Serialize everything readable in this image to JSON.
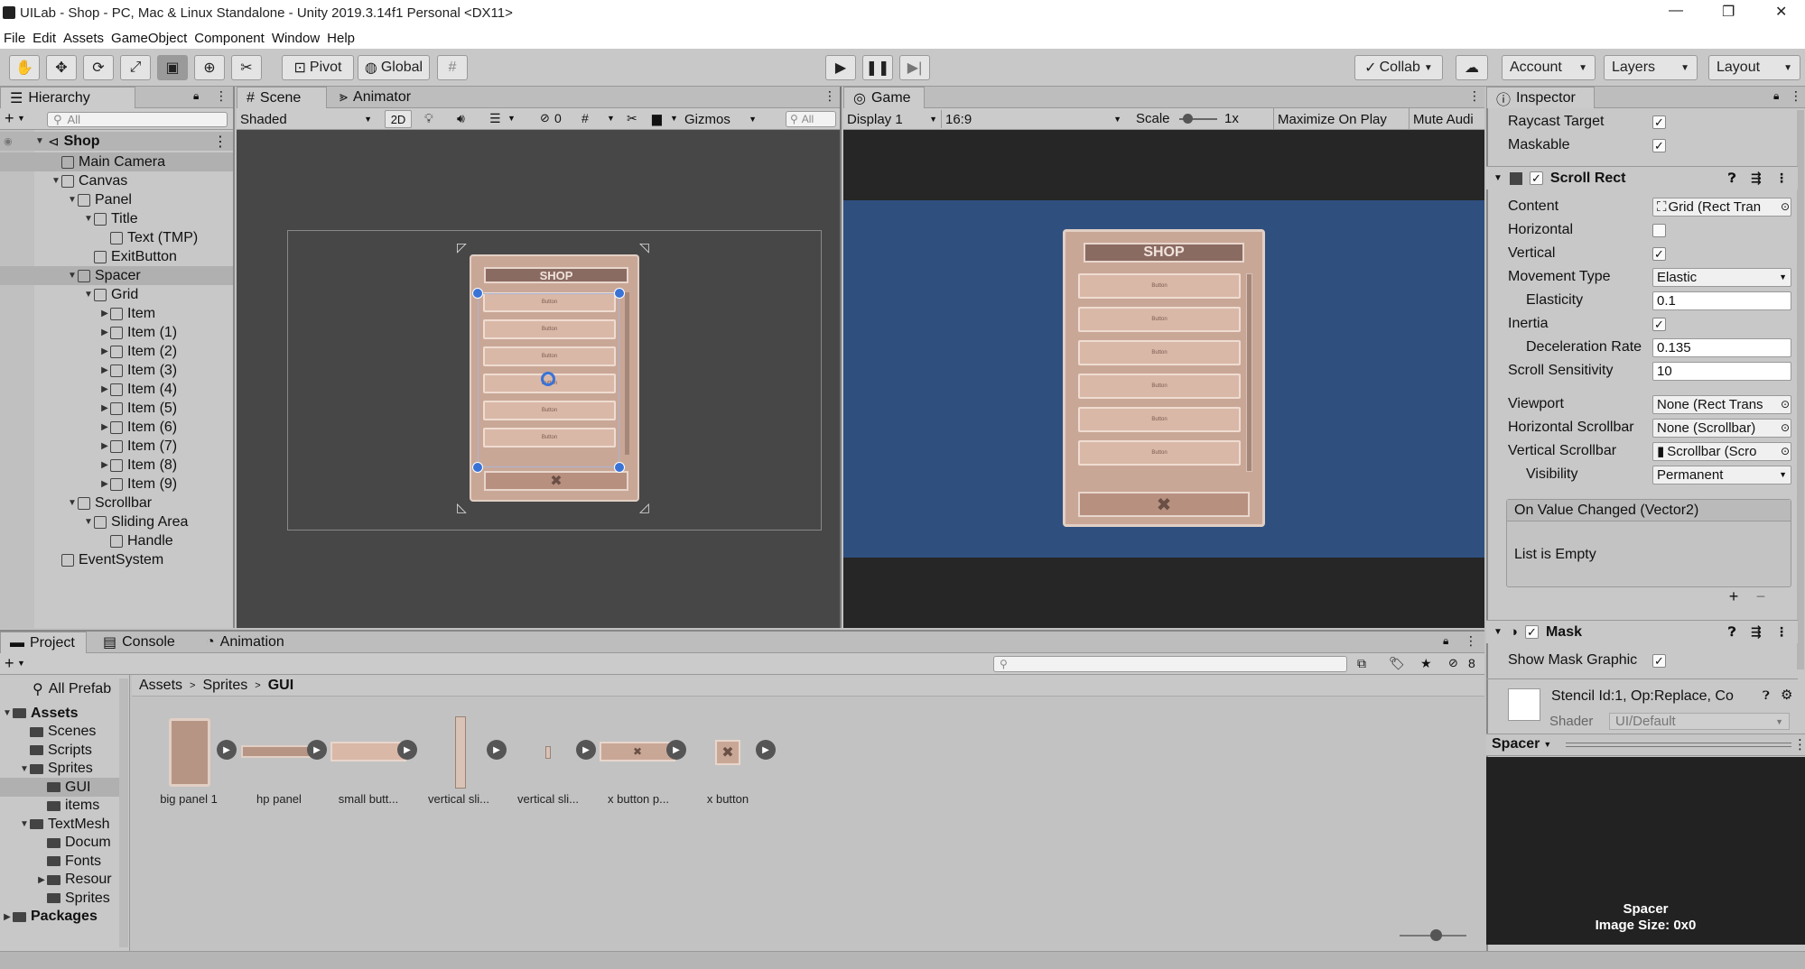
{
  "window": {
    "title": "UILab - Shop - PC, Mac & Linux Standalone - Unity 2019.3.14f1 Personal <DX11>",
    "controls": [
      "—",
      "❐",
      "✕"
    ]
  },
  "menu": [
    "File",
    "Edit",
    "Assets",
    "GameObject",
    "Component",
    "Window",
    "Help"
  ],
  "toolbar": {
    "pivot": "Pivot",
    "global": "Global",
    "collab": "Collab",
    "account": "Account",
    "layers": "Layers",
    "layout": "Layout"
  },
  "hierarchy": {
    "tab": "Hierarchy",
    "search_placeholder": "All",
    "root": "Shop",
    "items": [
      {
        "label": "Main Camera",
        "depth": 1,
        "arrow": ""
      },
      {
        "label": "Canvas",
        "depth": 1,
        "arrow": "▼"
      },
      {
        "label": "Panel",
        "depth": 2,
        "arrow": "▼"
      },
      {
        "label": "Title",
        "depth": 3,
        "arrow": "▼"
      },
      {
        "label": "Text (TMP)",
        "depth": 4,
        "arrow": ""
      },
      {
        "label": "ExitButton",
        "depth": 3,
        "arrow": ""
      },
      {
        "label": "Spacer",
        "depth": 2,
        "arrow": "▼"
      },
      {
        "label": "Grid",
        "depth": 3,
        "arrow": "▼"
      },
      {
        "label": "Item",
        "depth": 4,
        "arrow": "▶"
      },
      {
        "label": "Item (1)",
        "depth": 4,
        "arrow": "▶"
      },
      {
        "label": "Item (2)",
        "depth": 4,
        "arrow": "▶"
      },
      {
        "label": "Item (3)",
        "depth": 4,
        "arrow": "▶"
      },
      {
        "label": "Item (4)",
        "depth": 4,
        "arrow": "▶"
      },
      {
        "label": "Item (5)",
        "depth": 4,
        "arrow": "▶"
      },
      {
        "label": "Item (6)",
        "depth": 4,
        "arrow": "▶"
      },
      {
        "label": "Item (7)",
        "depth": 4,
        "arrow": "▶"
      },
      {
        "label": "Item (8)",
        "depth": 4,
        "arrow": "▶"
      },
      {
        "label": "Item (9)",
        "depth": 4,
        "arrow": "▶"
      },
      {
        "label": "Scrollbar",
        "depth": 2,
        "arrow": "▼"
      },
      {
        "label": "Sliding Area",
        "depth": 3,
        "arrow": "▼"
      },
      {
        "label": "Handle",
        "depth": 4,
        "arrow": ""
      },
      {
        "label": "EventSystem",
        "depth": 1,
        "arrow": ""
      }
    ]
  },
  "scene": {
    "tab_scene": "Scene",
    "tab_animator": "Animator",
    "shading": "Shaded",
    "mode_2d": "2D",
    "hidden_count": "0",
    "gizmos": "Gizmos",
    "search_placeholder": "All"
  },
  "game": {
    "tab": "Game",
    "display": "Display 1",
    "aspect": "16:9",
    "scale_label": "Scale",
    "scale_value": "1x",
    "maximize": "Maximize On Play",
    "mute": "Mute Audi"
  },
  "shop_panel": {
    "title": "SHOP",
    "button_label": "Button",
    "button_count": 6
  },
  "inspector": {
    "tab": "Inspector",
    "raycast_target": "Raycast Target",
    "maskable": "Maskable",
    "scroll_rect": {
      "header": "Scroll Rect",
      "content_label": "Content",
      "content_value": "Grid (Rect Tran",
      "horizontal_label": "Horizontal",
      "vertical_label": "Vertical",
      "movement_type_label": "Movement Type",
      "movement_type_value": "Elastic",
      "elasticity_label": "Elasticity",
      "elasticity_value": "0.1",
      "inertia_label": "Inertia",
      "decel_label": "Deceleration Rate",
      "decel_value": "0.135",
      "scroll_sens_label": "Scroll Sensitivity",
      "scroll_sens_value": "10",
      "viewport_label": "Viewport",
      "viewport_value": "None (Rect Trans",
      "hscroll_label": "Horizontal Scrollbar",
      "hscroll_value": "None (Scrollbar)",
      "vscroll_label": "Vertical Scrollbar",
      "vscroll_value": "Scrollbar (Scro",
      "visibility_label": "Visibility",
      "visibility_value": "Permanent",
      "event_label": "On Value Changed (Vector2)",
      "event_empty": "List is Empty",
      "plus": "+",
      "minus": "−"
    },
    "mask": {
      "header": "Mask",
      "show_graphic": "Show Mask Graphic"
    },
    "material": {
      "name": "Stencil Id:1, Op:Replace, Co",
      "shader_label": "Shader",
      "shader_value": "UI/Default"
    },
    "preview": {
      "dropdown": "Spacer",
      "name": "Spacer",
      "size": "Image Size: 0x0"
    }
  },
  "project": {
    "tab_project": "Project",
    "tab_console": "Console",
    "tab_animation": "Animation",
    "hidden_count": "8",
    "breadcrumb": [
      "Assets",
      "Sprites",
      "GUI"
    ],
    "tree_favorites": "All Prefab",
    "tree": [
      {
        "label": "Assets",
        "depth": 0,
        "arrow": "▼",
        "bold": true
      },
      {
        "label": "Scenes",
        "depth": 1,
        "arrow": ""
      },
      {
        "label": "Scripts",
        "depth": 1,
        "arrow": ""
      },
      {
        "label": "Sprites",
        "depth": 1,
        "arrow": "▼"
      },
      {
        "label": "GUI",
        "depth": 2,
        "arrow": "",
        "selected": true
      },
      {
        "label": "items",
        "depth": 2,
        "arrow": ""
      },
      {
        "label": "TextMesh",
        "depth": 1,
        "arrow": "▼"
      },
      {
        "label": "Docum",
        "depth": 2,
        "arrow": ""
      },
      {
        "label": "Fonts",
        "depth": 2,
        "arrow": ""
      },
      {
        "label": "Resour",
        "depth": 2,
        "arrow": "▶"
      },
      {
        "label": "Sprites",
        "depth": 2,
        "arrow": ""
      },
      {
        "label": "Packages",
        "depth": 0,
        "arrow": "▶",
        "bold": true
      }
    ],
    "assets": [
      "big panel 1",
      "hp panel",
      "small butt...",
      "vertical sli...",
      "vertical sli...",
      "x button p...",
      "x button"
    ]
  },
  "colors": {
    "game_bg": "#2f4f7f",
    "scene_bg": "#474747",
    "panel_wood": "#c9a797"
  }
}
